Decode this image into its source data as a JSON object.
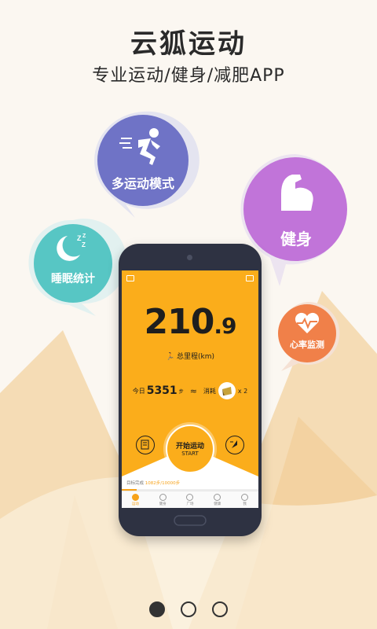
{
  "header": {
    "title": "云狐运动",
    "subtitle": "专业运动/健身/减肥APP"
  },
  "bubbles": {
    "multi_sport": {
      "label": "多运动模式",
      "color": "#6f73c6"
    },
    "fitness": {
      "label": "健身",
      "color": "#c174d9"
    },
    "sleep": {
      "label": "睡眠统计",
      "color": "#57c6c4"
    },
    "heart_rate": {
      "label": "心率监测",
      "color": "#f08049"
    }
  },
  "phone": {
    "distance_int": "210",
    "distance_dec": ".9",
    "distance_label": "总里程(km)",
    "today_label": "今日",
    "today_steps": "5351",
    "steps_unit": "步",
    "approx": "≈",
    "consume_label": "消耗",
    "consume_count": "x 2",
    "start_cn": "开始运动",
    "start_en": "START",
    "progress_prefix": "目标完成",
    "progress_value": "1082步/10000步",
    "progress_fraction": 0.108,
    "tabs": [
      {
        "label": "运动",
        "active": true
      },
      {
        "label": "健身",
        "active": false
      },
      {
        "label": "广场",
        "active": false
      },
      {
        "label": "健康",
        "active": false
      },
      {
        "label": "我",
        "active": false
      }
    ],
    "accent": "#fbad1b"
  },
  "pagination": {
    "current": 1,
    "total": 3
  }
}
